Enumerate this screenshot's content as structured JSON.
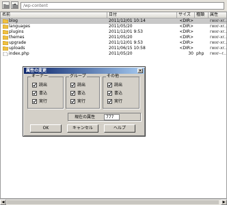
{
  "toolbar": {
    "path": "/wp-content"
  },
  "columns": {
    "name": "名前",
    "date": "日付",
    "size": "サイズ",
    "type": "種類",
    "attr": "属性"
  },
  "files": [
    {
      "name": "blog",
      "date": "2011/12/01 10:14",
      "size": "<DIR>",
      "type": "",
      "attr": "rwxr-xr...",
      "icon": "folder-icon"
    },
    {
      "name": "languages",
      "date": "2011/05/20",
      "size": "<DIR>",
      "type": "",
      "attr": "rwxr-xr...",
      "icon": "folder-icon"
    },
    {
      "name": "plugins",
      "date": "2011/12/01 9:53",
      "size": "<DIR>",
      "type": "",
      "attr": "rwxr-xr...",
      "icon": "folder-icon"
    },
    {
      "name": "themes",
      "date": "2011/05/20",
      "size": "<DIR>",
      "type": "",
      "attr": "rwxr-xr...",
      "icon": "folder-icon"
    },
    {
      "name": "upgrade",
      "date": "2011/12/01 9:53",
      "size": "<DIR>",
      "type": "",
      "attr": "rwxr-xr...",
      "icon": "folder-icon"
    },
    {
      "name": "uploads",
      "date": "2011/06/15 10:58",
      "size": "<DIR>",
      "type": "",
      "attr": "rwxr-xr...",
      "icon": "folder-icon"
    },
    {
      "name": "index.php",
      "date": "2011/05/20",
      "size": "30",
      "type": "php",
      "attr": "rwxr--r...",
      "icon": "file-icon"
    }
  ],
  "dialog": {
    "title": "属性の変更",
    "close": "×",
    "groups": [
      {
        "label": "オーナー",
        "items": [
          {
            "label": "読出",
            "checked": true
          },
          {
            "label": "書込",
            "checked": true
          },
          {
            "label": "実行",
            "checked": true
          }
        ]
      },
      {
        "label": "グループ",
        "items": [
          {
            "label": "読出",
            "checked": true
          },
          {
            "label": "書込",
            "checked": true
          },
          {
            "label": "実行",
            "checked": true
          }
        ]
      },
      {
        "label": "その他",
        "items": [
          {
            "label": "読出",
            "checked": true
          },
          {
            "label": "書込",
            "checked": true
          },
          {
            "label": "実行",
            "checked": true
          }
        ]
      }
    ],
    "current_label": "現在の属性",
    "current_value": "777",
    "ok": "OK",
    "cancel": "キャンセル",
    "help": "ヘルプ"
  }
}
